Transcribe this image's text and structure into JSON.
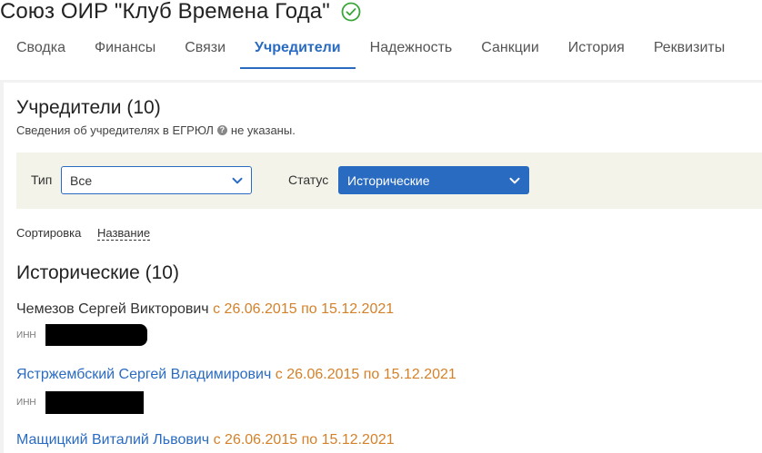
{
  "header": {
    "org_title": "Союз ОИР \"Клуб Времена Года\"",
    "verified_icon": "check-circle-icon",
    "verified_color": "#3aa63a"
  },
  "tabs": [
    {
      "label": "Сводка",
      "active": false
    },
    {
      "label": "Финансы",
      "active": false
    },
    {
      "label": "Связи",
      "active": false
    },
    {
      "label": "Учредители",
      "active": true
    },
    {
      "label": "Надежность",
      "active": false
    },
    {
      "label": "Санкции",
      "active": false
    },
    {
      "label": "История",
      "active": false
    },
    {
      "label": "Реквизиты",
      "active": false
    }
  ],
  "section": {
    "title": "Учредители (10)",
    "note_before": "Сведения об учредителях в ЕГРЮЛ",
    "note_after": "не указаны.",
    "help_icon": "question-circle-icon"
  },
  "filters": {
    "type_label": "Тип",
    "type_value": "Все",
    "status_label": "Статус",
    "status_value": "Исторические"
  },
  "sort": {
    "label": "Сортировка",
    "value": "Название"
  },
  "group": {
    "title": "Исторические (10)"
  },
  "founders": [
    {
      "name": "Чемезов Сергей Викторович",
      "dates": "с 26.06.2015 по 15.12.2021",
      "inn_label": "ИНН",
      "linked": false
    },
    {
      "name": "Ястржембский Сергей Владимирович",
      "dates": "с 26.06.2015 по 15.12.2021",
      "inn_label": "ИНН",
      "linked": true
    },
    {
      "name": "Мащицкий Виталий Львович",
      "dates": "с 26.06.2015 по 15.12.2021",
      "inn_label": "ИНН",
      "linked": true
    }
  ],
  "colors": {
    "accent": "#2a6bc2",
    "dates": "#d4812a",
    "filter_bg": "#f3f3e9"
  }
}
